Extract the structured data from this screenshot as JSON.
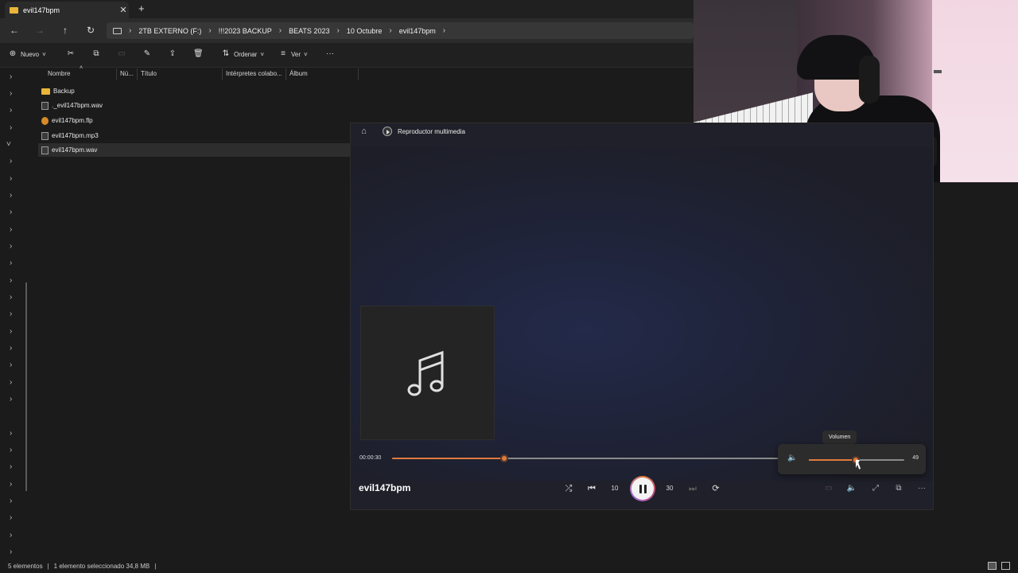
{
  "explorer": {
    "tab_title": "evil147bpm",
    "breadcrumbs": [
      "2TB EXTERNO (F:)",
      "!!!2023 BACKUP",
      "BEATS 2023",
      "10 Octubre",
      "evil147bpm"
    ],
    "toolbar": {
      "new_label": "Nuevo",
      "sort_label": "Ordenar",
      "view_label": "Ver"
    },
    "columns": [
      "Nombre",
      "Nú...",
      "Título",
      "Intérpretes colabo...",
      "Álbum"
    ],
    "files": [
      {
        "name": "Backup",
        "type": "folder"
      },
      {
        "name": "._evil147bpm.wav",
        "type": "file"
      },
      {
        "name": "evil147bpm.flp",
        "type": "flp"
      },
      {
        "name": "evil147bpm.mp3",
        "type": "file"
      },
      {
        "name": "evil147bpm.wav",
        "type": "file",
        "selected": true
      }
    ],
    "status": {
      "count": "5 elementos",
      "selection": "1 elemento seleccionado  34,8 MB"
    }
  },
  "player": {
    "app_title": "Reproductor multimedia",
    "elapsed": "00:00:30",
    "progress_fraction": 0.29,
    "track_title": "evil147bpm",
    "skip_back_label": "10",
    "skip_forward_label": "30",
    "volume": {
      "tooltip": "Volumen",
      "value": "49",
      "fraction": 0.49
    },
    "accent_color": "#e07a3c"
  }
}
